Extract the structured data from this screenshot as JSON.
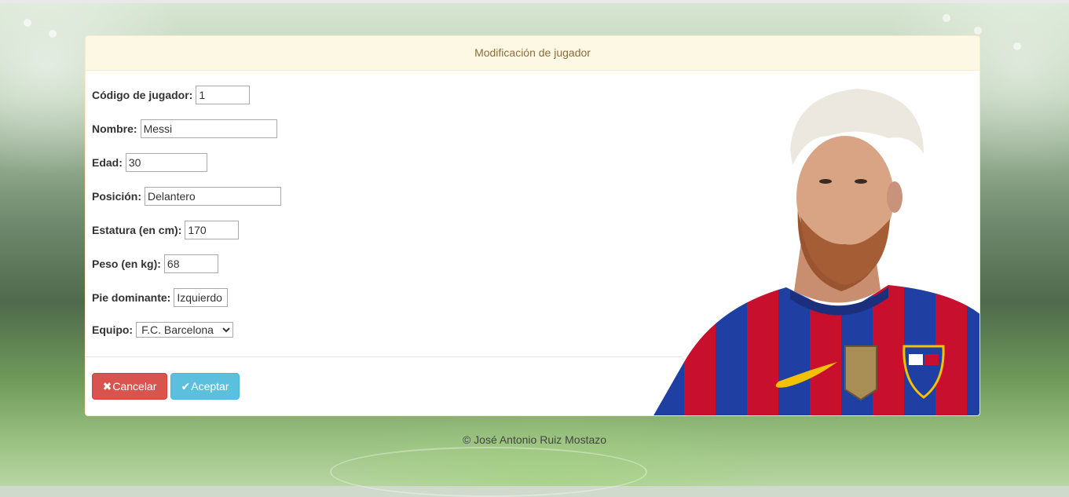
{
  "panel": {
    "title": "Modificación de jugador"
  },
  "form": {
    "codigo": {
      "label": "Código de jugador:",
      "value": "1"
    },
    "nombre": {
      "label": "Nombre:",
      "value": "Messi"
    },
    "edad": {
      "label": "Edad:",
      "value": "30"
    },
    "posicion": {
      "label": "Posición:",
      "value": "Delantero"
    },
    "estatura": {
      "label": "Estatura (en cm):",
      "value": "170"
    },
    "peso": {
      "label": "Peso (en kg):",
      "value": "68"
    },
    "pie": {
      "label": "Pie dominante:",
      "value": "Izquierdo"
    },
    "equipo": {
      "label": "Equipo:",
      "selected": "F.C. Barcelona"
    }
  },
  "buttons": {
    "cancel": {
      "icon": "✖",
      "label": "Cancelar",
      "color": "#d9534f"
    },
    "accept": {
      "icon": "✔",
      "label": "Aceptar",
      "color": "#5bc0de"
    }
  },
  "footer": {
    "text": "© José Antonio Ruiz Mostazo"
  },
  "colors": {
    "heading_bg": "#fcf8e3",
    "heading_text": "#8a6d3b",
    "blaugrana_red": "#c8102e",
    "blaugrana_blue": "#1f3fa3"
  },
  "icons": {
    "cancel": "close-icon",
    "accept": "check-icon"
  }
}
